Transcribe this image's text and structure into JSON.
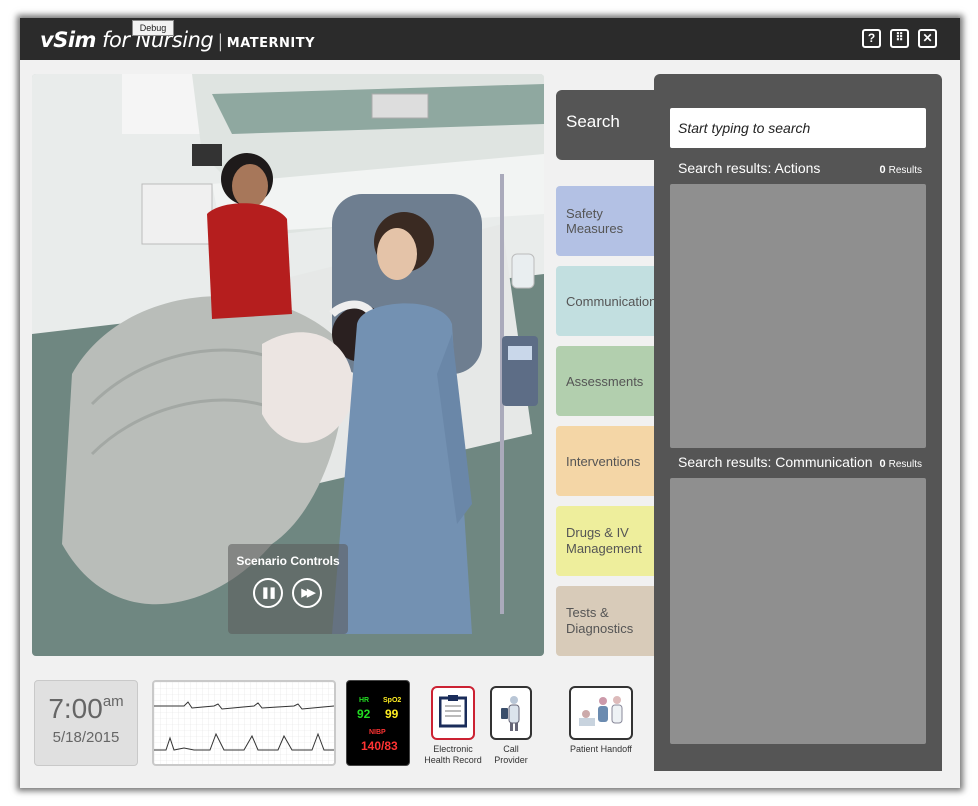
{
  "app": {
    "brand_main": "vSim",
    "brand_sub": "for Nursing",
    "separator": "|",
    "product": "MATERNITY",
    "debug_label": "Debug",
    "help_icon": "question-mark-icon",
    "help_glyph": "?",
    "grid_icon": "grid-icon",
    "grid_glyph": "⠿",
    "close_icon": "close-icon",
    "close_glyph": "✕"
  },
  "scenario_controls": {
    "label": "Scenario Controls",
    "pause_glyph": "❚❚",
    "forward_glyph": "▶▶"
  },
  "tabs": {
    "search": "Search",
    "categories": [
      {
        "label": "Safety Measures",
        "color": "#b3c1e4"
      },
      {
        "label": "Communication",
        "color": "#c2dfe0"
      },
      {
        "label": "Assessments",
        "color": "#b2cfae"
      },
      {
        "label": "Interventions",
        "color": "#f4d6a6"
      },
      {
        "label": "Drugs & IV Management",
        "color": "#eeee9c"
      },
      {
        "label": "Tests & Diagnostics",
        "color": "#d8cbb9"
      }
    ]
  },
  "search_panel": {
    "placeholder": "Start typing to search",
    "actions": {
      "heading": "Search results: Actions",
      "count": "0",
      "count_label": "Results"
    },
    "communication": {
      "heading": "Search results: Communication",
      "count": "0",
      "count_label": "Results"
    }
  },
  "clock": {
    "time": "7:00",
    "ampm": "am",
    "date": "5/18/2015"
  },
  "vitals": {
    "hr_label": "HR",
    "hr_value": "92",
    "spo2_label": "SpO2",
    "spo2_value": "99",
    "nibp_label": "NIBP",
    "nibp_value": "140/83",
    "hr_color": "#22dd22",
    "spo2_color": "#ffee22",
    "nibp_color": "#ff3333"
  },
  "toolbar": {
    "ehr": {
      "label": "Electronic Health Record",
      "icon": "clipboard-icon"
    },
    "call_provider": {
      "label": "Call Provider",
      "icon": "phone-icon"
    },
    "handoff": {
      "label": "Patient Handoff",
      "icon": "people-icon"
    }
  }
}
